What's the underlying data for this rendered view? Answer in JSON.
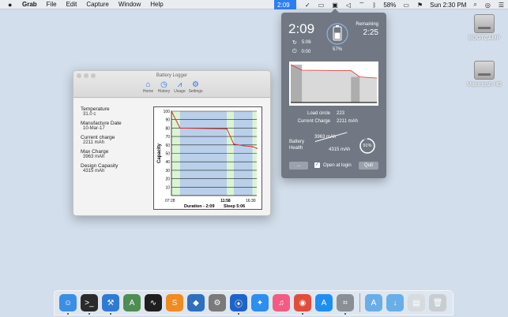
{
  "menubar": {
    "apple": "",
    "menus": [
      "Grab",
      "File",
      "Edit",
      "Capture",
      "Window",
      "Help"
    ],
    "timer": "2:09",
    "battery_percent": "58%",
    "clock": "Sun 2:30 PM"
  },
  "desktop": {
    "drives": [
      {
        "label": "BOOTCAMP"
      },
      {
        "label": "Macintosh HD"
      }
    ]
  },
  "window": {
    "title": "Battery Logger",
    "tabs": [
      {
        "label": "Home",
        "icon": "home-icon"
      },
      {
        "label": "History",
        "icon": "clock-icon"
      },
      {
        "label": "Usage",
        "icon": "chart-icon"
      },
      {
        "label": "Settings",
        "icon": "gear-icon"
      }
    ],
    "stats": [
      {
        "label": "Temperature",
        "value": "31.0 c"
      },
      {
        "label": "Manufacture Date",
        "value": "10-Mar-17"
      },
      {
        "label": "Current charge",
        "value": "2211 mAh"
      },
      {
        "label": "Max Charge",
        "value": "3963 mAh"
      },
      {
        "label": "Design Capasity",
        "value": "4315 mAh"
      }
    ],
    "chart_data": {
      "type": "line",
      "ylabel": "Capacity",
      "ylim": [
        0,
        100
      ],
      "yticks": [
        10,
        20,
        30,
        40,
        50,
        60,
        70,
        80,
        90,
        100
      ],
      "x_start_label": "07:28",
      "x_mid_label": "11:58",
      "x_end_label": "16:30",
      "caption_duration": "Duration - 2:09",
      "caption_sleep": "Sleep 5:06",
      "series": [
        {
          "x": [
            0,
            0.1,
            0.65,
            0.73,
            0.85,
            0.95,
            1.0
          ],
          "values": [
            100,
            80,
            79,
            61,
            59,
            58,
            56
          ]
        }
      ],
      "charging_bands": [
        [
          0,
          0.1
        ],
        [
          0.65,
          0.73
        ],
        [
          0.95,
          1.0
        ]
      ],
      "discharging_bands": [
        [
          0.1,
          0.65
        ],
        [
          0.73,
          0.95
        ]
      ]
    }
  },
  "popover": {
    "time": "2:09",
    "charge_time": "5:06",
    "idle_time": "0:00",
    "battery_percent": "57%",
    "battery_level": 0.57,
    "remaining_label": "Remaining",
    "remaining": "2:25",
    "load_circle_label": "Load circle",
    "load_circle_value": "223",
    "current_charge_label": "Current Charge",
    "current_charge_value": "2211 mAh",
    "health_label_1": "Battery",
    "health_label_2": "Health",
    "max_capacity": "3963 mAh",
    "design_capacity": "4315 mAh",
    "health_percent": "91%",
    "health_level": 0.91,
    "more_button": "...",
    "open_at_login": "Open at login",
    "quit_button": "Quit",
    "chart_data": {
      "type": "area",
      "ylim": [
        0,
        100
      ],
      "series": [
        {
          "x": [
            0,
            0.13,
            0.7,
            0.8,
            1.0
          ],
          "values": [
            96,
            82,
            81,
            65,
            62
          ]
        }
      ]
    }
  },
  "dock": {
    "items": [
      {
        "name": "finder-icon",
        "glyph": "☺",
        "color": "#3a8ee6",
        "running": true
      },
      {
        "name": "terminal-icon",
        "glyph": ">_",
        "color": "#2b2b2b",
        "running": true
      },
      {
        "name": "xcode-icon",
        "glyph": "⚒",
        "color": "#2f7bd4",
        "running": true
      },
      {
        "name": "android-studio-icon",
        "glyph": "A",
        "color": "#4f8d54",
        "running": false
      },
      {
        "name": "activity-monitor-icon",
        "glyph": "∿",
        "color": "#1f1f1f",
        "running": false
      },
      {
        "name": "sublime-text-icon",
        "glyph": "S",
        "color": "#f08b1f",
        "running": false
      },
      {
        "name": "visual-studio-code-icon",
        "glyph": "◆",
        "color": "#2f6fc0",
        "running": false
      },
      {
        "name": "system-preferences-icon",
        "glyph": "⚙",
        "color": "#7a7a7a",
        "running": false
      },
      {
        "name": "battery-logger-icon",
        "glyph": "⦿",
        "color": "#1e64c8",
        "running": true
      },
      {
        "name": "safari-icon",
        "glyph": "✦",
        "color": "#2b8ef0",
        "running": false
      },
      {
        "name": "music-icon",
        "glyph": "♫",
        "color": "#f25c83",
        "running": false
      },
      {
        "name": "chrome-icon",
        "glyph": "◉",
        "color": "#e24c3c",
        "running": true
      },
      {
        "name": "app-store-icon",
        "glyph": "A",
        "color": "#1e8ff0",
        "running": false
      },
      {
        "name": "grab-icon",
        "glyph": "⌗",
        "color": "#8a8f96",
        "running": true
      },
      {
        "name": "applications-folder-icon",
        "glyph": "A",
        "color": "#6aaee8",
        "running": false
      },
      {
        "name": "downloads-folder-icon",
        "glyph": "↓",
        "color": "#6aaee8",
        "running": false
      },
      {
        "name": "preview-icon",
        "glyph": "▤",
        "color": "#d6dbe0",
        "running": false
      },
      {
        "name": "trash-icon",
        "glyph": "🗑",
        "color": "#c8cdd2",
        "running": false
      }
    ]
  }
}
